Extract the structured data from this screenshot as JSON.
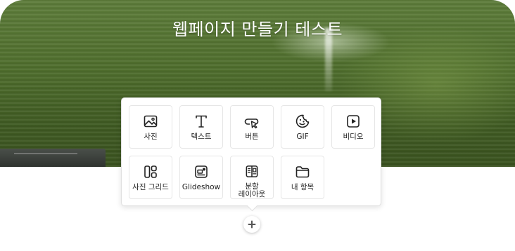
{
  "hero": {
    "title": "웹페이지 만들기 테스트"
  },
  "insert_menu": {
    "items": [
      {
        "label": "사진",
        "icon": "image-icon"
      },
      {
        "label": "텍스트",
        "icon": "text-icon"
      },
      {
        "label": "버튼",
        "icon": "button-icon"
      },
      {
        "label": "GIF",
        "icon": "gif-icon"
      },
      {
        "label": "비디오",
        "icon": "video-icon"
      },
      {
        "label": "사진 그리드",
        "icon": "photo-grid-icon"
      },
      {
        "label": "Glideshow",
        "icon": "glideshow-icon"
      },
      {
        "label": "분할 레이아웃",
        "icon": "split-layout-icon"
      },
      {
        "label": "내 항목",
        "icon": "folder-icon"
      }
    ]
  },
  "add_button": {
    "icon": "plus-icon"
  }
}
